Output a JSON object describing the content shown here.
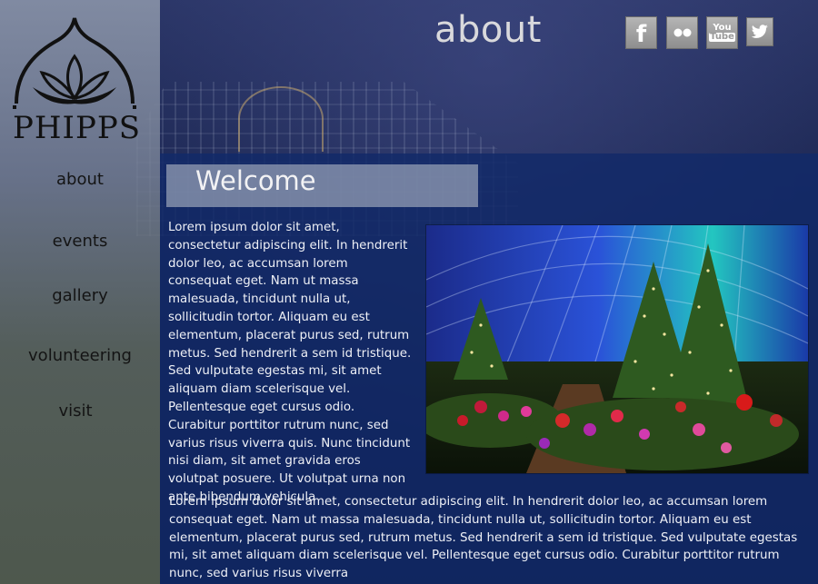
{
  "header": {
    "title": "about"
  },
  "logo": {
    "text": "PHIPPS"
  },
  "nav": {
    "items": [
      {
        "label": "about"
      },
      {
        "label": "events"
      },
      {
        "label": "gallery"
      },
      {
        "label": "volunteering"
      },
      {
        "label": "visit"
      }
    ]
  },
  "social": {
    "icons": [
      "facebook-icon",
      "flickr-icon",
      "youtube-icon",
      "twitter-icon"
    ],
    "facebook": "f",
    "youtube_top": "You",
    "youtube_bottom": "Tube"
  },
  "main": {
    "heading": "Welcome",
    "paragraph1": "Lorem ipsum dolor sit amet, consectetur adipiscing elit. In hendrerit dolor leo, ac accumsan lorem consequat eget. Nam ut massa malesuada, tincidunt nulla ut, sollicitudin tortor. Aliquam eu est elementum, placerat purus sed, rutrum metus. Sed hendrerit a sem id tristique. Sed vulputate egestas mi, sit amet aliquam diam scelerisque vel. Pellentesque eget cursus odio. Curabitur porttitor rutrum nunc, sed varius risus viverra quis. Nunc tincidunt nisi diam, sit amet gravida eros volutpat posuere. Ut volutpat urna non ante bibendum vehicula",
    "paragraph2": "Lorem ipsum dolor sit amet, consectetur adipiscing elit. In hendrerit dolor leo, ac accumsan lorem consequat eget. Nam ut massa malesuada, tincidunt nulla ut, sollicitudin tortor. Aliquam eu est elementum, placerat purus sed, rutrum metus. Sed hendrerit a sem id tristique. Sed vulputate egestas mi, sit amet aliquam diam scelerisque vel. Pellentesque eget cursus odio. Curabitur porttitor rutrum nunc, sed varius risus viverra"
  },
  "colors": {
    "content_panel": "#122a69",
    "sidebar": "#8c96aa",
    "title": "#d9d9dc"
  }
}
